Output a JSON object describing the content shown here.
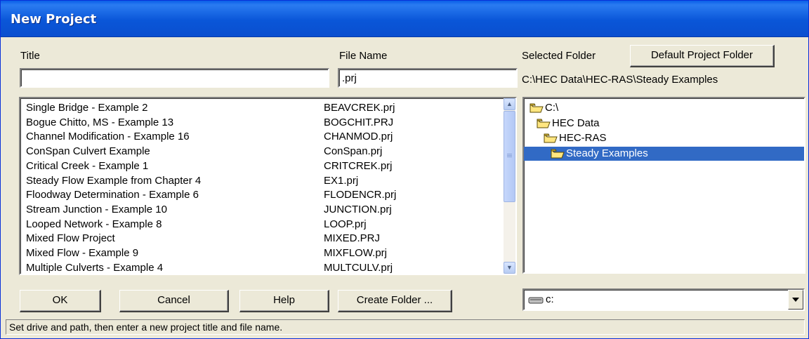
{
  "window": {
    "title": "New Project"
  },
  "labels": {
    "title": "Title",
    "file_name": "File Name",
    "selected_folder": "Selected Folder"
  },
  "inputs": {
    "title_value": "",
    "file_name_value": ".prj"
  },
  "selected_folder_path": "C:\\HEC Data\\HEC-RAS\\Steady Examples",
  "buttons": {
    "default_project_folder": "Default Project Folder",
    "ok": "OK",
    "cancel": "Cancel",
    "help": "Help",
    "create_folder": "Create Folder ..."
  },
  "projects": [
    {
      "title": "Single Bridge - Example 2",
      "file": "BEAVCREK.prj"
    },
    {
      "title": "Bogue Chitto, MS - Example 13",
      "file": "BOGCHIT.PRJ"
    },
    {
      "title": "Channel Modification - Example 16",
      "file": "CHANMOD.prj"
    },
    {
      "title": "ConSpan Culvert Example",
      "file": "ConSpan.prj"
    },
    {
      "title": "Critical Creek - Example 1",
      "file": "CRITCREK.prj"
    },
    {
      "title": "Steady Flow Example from Chapter 4",
      "file": "EX1.prj"
    },
    {
      "title": "Floodway Determination - Example 6",
      "file": "FLODENCR.prj"
    },
    {
      "title": "Stream Junction - Example 10",
      "file": "JUNCTION.prj"
    },
    {
      "title": "Looped Network - Example 8",
      "file": "LOOP.prj"
    },
    {
      "title": "Mixed Flow Project",
      "file": "MIXED.PRJ"
    },
    {
      "title": "Mixed Flow - Example 9",
      "file": "MIXFLOW.prj"
    },
    {
      "title": "Multiple Culverts - Example 4",
      "file": "MULTCULV.prj"
    }
  ],
  "folder_tree": [
    {
      "label": "C:\\",
      "level": 0,
      "selected": false,
      "icon": "open-folder-icon"
    },
    {
      "label": "HEC Data",
      "level": 1,
      "selected": false,
      "icon": "open-folder-icon"
    },
    {
      "label": "HEC-RAS",
      "level": 2,
      "selected": false,
      "icon": "open-folder-icon"
    },
    {
      "label": "Steady Examples",
      "level": 3,
      "selected": true,
      "icon": "open-folder-icon"
    }
  ],
  "drive": {
    "value": "c:",
    "icon": "drive-icon"
  },
  "status_text": "Set drive and path, then enter a new project title and file name.",
  "colors": {
    "titlebar": "#0a56d8",
    "selection": "#316ac5",
    "dialog_bg": "#ece9d8"
  }
}
